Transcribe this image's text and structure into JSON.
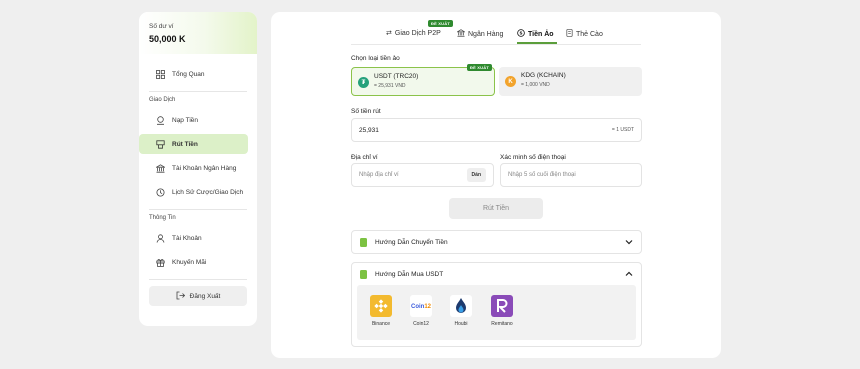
{
  "sidebar": {
    "balance_label": "Số dư ví",
    "balance_value": "50,000 K",
    "items": [
      {
        "label": "Tổng Quan"
      },
      {
        "label": "Nạp Tiền"
      },
      {
        "label": "Rút Tiền"
      },
      {
        "label": "Tài Khoản Ngân Hàng"
      },
      {
        "label": "Lịch Sử Cược/Giao Dịch"
      },
      {
        "label": "Tài Khoản"
      },
      {
        "label": "Khuyến Mãi"
      }
    ],
    "section_transactions": "Giao Dịch",
    "section_info": "Thông Tin",
    "logout_label": "Đăng Xuất"
  },
  "tabs": [
    {
      "label": "Giao Dịch P2P",
      "badge": "ĐỀ XUẤT"
    },
    {
      "label": "Ngân Hàng"
    },
    {
      "label": "Tiền Ảo"
    },
    {
      "label": "Thẻ Cào"
    }
  ],
  "active_tab": "Tiền Ảo",
  "crypto": {
    "select_label": "Chọn loại tiền ảo",
    "options": [
      {
        "name": "USDT (TRC20)",
        "rate": "= 25,931 VND",
        "badge": "ĐỀ XUẤT",
        "selected": true
      },
      {
        "name": "KDG (KCHAIN)",
        "rate": "= 1,000 VND",
        "selected": false
      }
    ]
  },
  "amount": {
    "label": "Số tiền rút",
    "value": "25,931",
    "suffix": "= 1 USDT"
  },
  "address": {
    "label": "Địa chỉ ví",
    "placeholder": "Nhập địa chỉ ví",
    "paste_label": "Dán"
  },
  "phone": {
    "label": "Xác minh số điện thoại",
    "placeholder": "Nhập 5 số cuối điện thoại"
  },
  "submit_label": "Rút Tiền",
  "guides": [
    {
      "title": "Hướng Dẫn Chuyển Tiền",
      "expanded": false
    },
    {
      "title": "Hướng Dẫn Mua USDT",
      "expanded": true
    }
  ],
  "exchanges": [
    {
      "name": "Binance",
      "color": "#f3ba2f"
    },
    {
      "name": "Coin12",
      "color": "#ffffff"
    },
    {
      "name": "Houbi",
      "color": "#1d3a6e"
    },
    {
      "name": "Remitano",
      "color": "#8a4bb8"
    }
  ],
  "colors": {
    "accent": "#5b9e3b",
    "active_bg": "#dcf0c8",
    "badge": "#2f8a2f",
    "usdt": "#26a17b",
    "kdg": "#f2a32c"
  }
}
